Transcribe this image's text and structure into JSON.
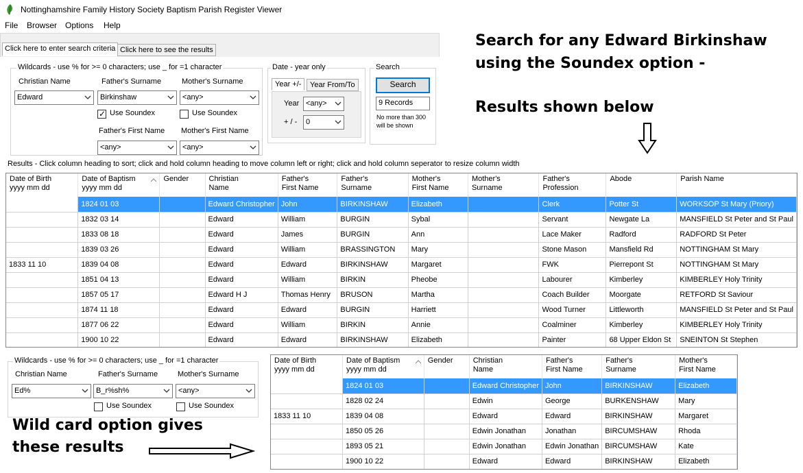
{
  "window": {
    "title": "Nottinghamshire Family History Society Baptism Parish Register Viewer"
  },
  "menu": [
    "File",
    "Browser",
    "Options",
    "Help"
  ],
  "tabs": {
    "criteria": "Click here to enter search criteria",
    "results": "Click here to see the results"
  },
  "search1": {
    "wildcards_legend": "Wildcards - use  %  for >= 0 characters;  use   _  for =1 character",
    "christian_name_label": "Christian Name",
    "christian_name_value": "Edward",
    "father_surname_label": "Father's Surname",
    "father_surname_value": "Birkinshaw",
    "mother_surname_label": "Mother's Surname",
    "mother_surname_value": "<any>",
    "use_soundex_label": "Use Soundex",
    "father_soundex_checked": true,
    "mother_soundex_checked": false,
    "father_first_label": "Father's First Name",
    "father_first_value": "<any>",
    "mother_first_label": "Mother's First Name",
    "mother_first_value": "<any>",
    "date_legend": "Date - year only",
    "year_tab": "Year +/-",
    "yearfromto_tab": "Year From/To",
    "year_label": "Year",
    "year_value": "<any>",
    "plusminus_label": "+ / -",
    "plusminus_value": "0",
    "search_legend": "Search",
    "search_button": "Search",
    "records_count": "9 Records",
    "limit_note_1": "No more than 300",
    "limit_note_2": "will be shown"
  },
  "annotations": {
    "top_line1": "Search for any Edward Birkinshaw",
    "top_line2": "using the Soundex option -",
    "top_line3": "Results shown below",
    "bottom_line1": "Wild card option gives",
    "bottom_line2": "these results"
  },
  "results_caption": "Results - Click column heading to sort; click and hold column heading to move column left or right; click and hold column seperator to resize column width",
  "grid1": {
    "columns": [
      [
        "Date of Birth",
        "yyyy mm dd"
      ],
      [
        "Date of Baptism",
        "yyyy mm dd"
      ],
      [
        "Gender",
        ""
      ],
      [
        "Christian",
        "Name"
      ],
      [
        "Father's",
        "First Name"
      ],
      [
        "Father's",
        "Surname"
      ],
      [
        "Mother's",
        "First Name"
      ],
      [
        "Mother's",
        "Surname"
      ],
      [
        "Father's",
        "Profession"
      ],
      [
        "Abode",
        ""
      ],
      [
        "Parish Name",
        ""
      ]
    ],
    "rows": [
      [
        "",
        "1824 01 03",
        "",
        "Edward Christopher",
        "John",
        "BIRKINSHAW",
        "Elizabeth",
        "",
        "Clerk",
        "Potter St",
        "WORKSOP St Mary (Priory)"
      ],
      [
        "",
        "1832 03 14",
        "",
        "Edward",
        "William",
        "BURGIN",
        "Sybal",
        "",
        "Servant",
        "Newgate La",
        "MANSFIELD St Peter and St Paul"
      ],
      [
        "",
        "1833 08 18",
        "",
        "Edward",
        "James",
        "BURGIN",
        "Ann",
        "",
        "Lace Maker",
        "Radford",
        "RADFORD St Peter"
      ],
      [
        "",
        "1839 03 26",
        "",
        "Edward",
        "William",
        "BRASSINGTON",
        "Mary",
        "",
        "Stone Mason",
        "Mansfield Rd",
        "NOTTINGHAM St Mary"
      ],
      [
        "1833 11 10",
        "1839 04 08",
        "",
        "Edward",
        "Edward",
        "BIRKINSHAW",
        "Margaret",
        "",
        "FWK",
        "Pierrepont St",
        "NOTTINGHAM St Mary"
      ],
      [
        "",
        "1851 04 13",
        "",
        "Edward",
        "William",
        "BIRKIN",
        "Pheobe",
        "",
        "Labourer",
        "Kimberley",
        "KIMBERLEY Holy Trinity"
      ],
      [
        "",
        "1857 05 17",
        "",
        "Edward H J",
        "Thomas Henry",
        "BRUSON",
        "Martha",
        "",
        "Coach Builder",
        "Moorgate",
        "RETFORD St Saviour"
      ],
      [
        "",
        "1874 11 18",
        "",
        "Edward",
        "Edward",
        "BURGIN",
        "Harriett",
        "",
        "Wood Turner",
        "Littleworth",
        "MANSFIELD St Peter and St Paul"
      ],
      [
        "",
        "1877 06 22",
        "",
        "Edward",
        "William",
        "BIRKIN",
        "Annie",
        "",
        "Coalminer",
        "Kimberley",
        "KIMBERLEY Holy Trinity"
      ],
      [
        "",
        "1900 10 22",
        "",
        "Edward",
        "Edward",
        "BIRKINSHAW",
        "Elizabeth",
        "",
        "Painter",
        "68 Upper Eldon St",
        "SNEINTON St Stephen"
      ]
    ]
  },
  "search2": {
    "wildcards_legend": "Wildcards - use  %  for >= 0 characters;  use   _  for =1 character",
    "christian_name_label": "Christian Name",
    "christian_name_value": "Ed%",
    "father_surname_label": "Father's Surname",
    "father_surname_value": "B_r%sh%",
    "mother_surname_label": "Mother's Surname",
    "mother_surname_value": "<any>",
    "use_soundex_label": "Use Soundex"
  },
  "grid2": {
    "columns": [
      [
        "Date of Birth",
        "yyyy mm dd"
      ],
      [
        "Date of Baptism",
        "yyyy mm dd"
      ],
      [
        "Gender",
        ""
      ],
      [
        "Christian",
        "Name"
      ],
      [
        "Father's",
        "First Name"
      ],
      [
        "Father's",
        "Surname"
      ],
      [
        "Mother's",
        "First Name"
      ]
    ],
    "rows": [
      [
        "",
        "1824 01 03",
        "",
        "Edward Christopher",
        "John",
        "BIRKINSHAW",
        "Elizabeth"
      ],
      [
        "",
        "1828 02 24",
        "",
        "Edwin",
        "George",
        "BURKENSHAW",
        "Mary"
      ],
      [
        "1833 11 10",
        "1839 04 08",
        "",
        "Edward",
        "Edward",
        "BIRKINSHAW",
        "Margaret"
      ],
      [
        "",
        "1850 05 26",
        "",
        "Edwin Jonathan",
        "Jonathan",
        "BIRCUMSHAW",
        "Rhoda"
      ],
      [
        "",
        "1893 05 21",
        "",
        "Edwin Jonathan",
        "Edwin Jonathan",
        "BIRCUMSHAW",
        "Kate"
      ],
      [
        "",
        "1900 10 22",
        "",
        "Edward",
        "Edward",
        "BIRKINSHAW",
        "Elizabeth"
      ]
    ]
  },
  "colors": {
    "selection": "#3399ff",
    "button_border": "#0078d7"
  }
}
